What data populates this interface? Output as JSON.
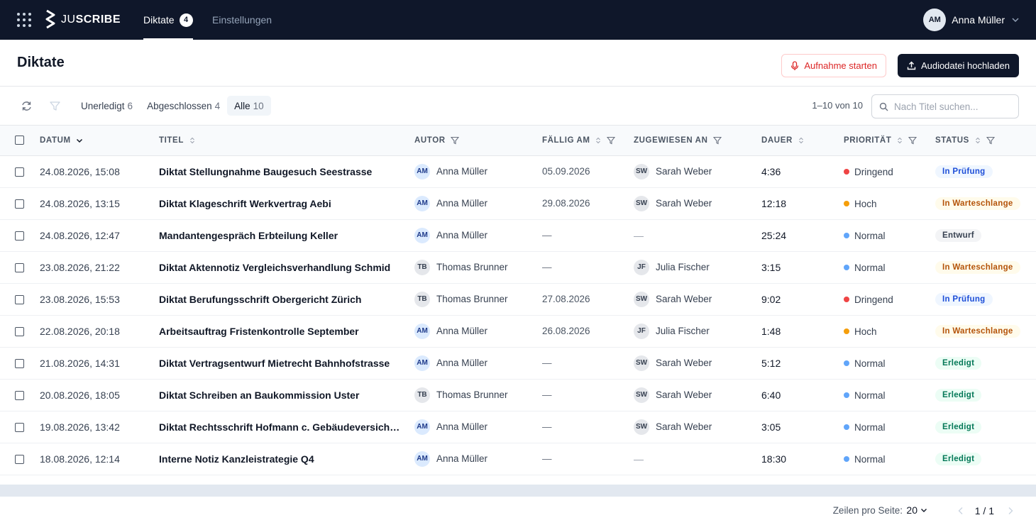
{
  "app": {
    "brand_prefix": "JU",
    "brand_suffix": "SCRIBE",
    "nav": [
      {
        "label": "Diktate",
        "badge": "4",
        "active": true
      },
      {
        "label": "Einstellungen",
        "active": false
      }
    ],
    "user": {
      "initials": "AM",
      "name": "Anna Müller"
    }
  },
  "header": {
    "title": "Diktate",
    "record_label": "Aufnahme starten",
    "upload_label": "Audiodatei hochladen"
  },
  "toolbar": {
    "filters": [
      {
        "label": "Unerledigt",
        "count": "6"
      },
      {
        "label": "Abgeschlossen",
        "count": "4"
      },
      {
        "label": "Alle",
        "count": "10",
        "active": true
      }
    ],
    "range": "1–10 von 10",
    "search_placeholder": "Nach Titel suchen..."
  },
  "columns": {
    "date": "Datum",
    "title": "Titel",
    "author": "Autor",
    "due": "Fällig am",
    "assigned": "Zugewiesen an",
    "duration": "Dauer",
    "priority": "Priorität",
    "status": "Status"
  },
  "rows": [
    {
      "date": "24.08.2026, 15:08",
      "title": "Diktat Stellungnahme Baugesuch Seestrasse",
      "author_initials": "AM",
      "author": "Anna Müller",
      "due": "05.09.2026",
      "assignee_initials": "SW",
      "assignee": "Sarah Weber",
      "duration": "4:36",
      "priority": "Dringend",
      "status": "In Prüfung"
    },
    {
      "date": "24.08.2026, 13:15",
      "title": "Diktat Klageschrift Werkvertrag Aebi",
      "author_initials": "AM",
      "author": "Anna Müller",
      "due": "29.08.2026",
      "assignee_initials": "SW",
      "assignee": "Sarah Weber",
      "duration": "12:18",
      "priority": "Hoch",
      "status": "In Warteschlange"
    },
    {
      "date": "24.08.2026, 12:47",
      "title": "Mandantengespräch Erbteilung Keller",
      "author_initials": "AM",
      "author": "Anna Müller",
      "due": "—",
      "assignee_initials": "",
      "assignee": "—",
      "duration": "25:24",
      "priority": "Normal",
      "status": "Entwurf"
    },
    {
      "date": "23.08.2026, 21:22",
      "title": "Diktat Aktennotiz Vergleichsverhandlung Schmid",
      "author_initials": "TB",
      "author": "Thomas Brunner",
      "due": "—",
      "assignee_initials": "JF",
      "assignee": "Julia Fischer",
      "duration": "3:15",
      "priority": "Normal",
      "status": "In Warteschlange"
    },
    {
      "date": "23.08.2026, 15:53",
      "title": "Diktat Berufungsschrift Obergericht Zürich",
      "author_initials": "TB",
      "author": "Thomas Brunner",
      "due": "27.08.2026",
      "assignee_initials": "SW",
      "assignee": "Sarah Weber",
      "duration": "9:02",
      "priority": "Dringend",
      "status": "In Prüfung"
    },
    {
      "date": "22.08.2026, 20:18",
      "title": "Arbeitsauftrag Fristenkontrolle September",
      "author_initials": "AM",
      "author": "Anna Müller",
      "due": "26.08.2026",
      "assignee_initials": "JF",
      "assignee": "Julia Fischer",
      "duration": "1:48",
      "priority": "Hoch",
      "status": "In Warteschlange"
    },
    {
      "date": "21.08.2026, 14:31",
      "title": "Diktat Vertragsentwurf Mietrecht Bahnhofstrasse",
      "author_initials": "AM",
      "author": "Anna Müller",
      "due": "—",
      "assignee_initials": "SW",
      "assignee": "Sarah Weber",
      "duration": "5:12",
      "priority": "Normal",
      "status": "Erledigt"
    },
    {
      "date": "20.08.2026, 18:05",
      "title": "Diktat Schreiben an Baukommission Uster",
      "author_initials": "TB",
      "author": "Thomas Brunner",
      "due": "—",
      "assignee_initials": "SW",
      "assignee": "Sarah Weber",
      "duration": "6:40",
      "priority": "Normal",
      "status": "Erledigt"
    },
    {
      "date": "19.08.2026, 13:42",
      "title": "Diktat Rechtsschrift Hofmann c. Gebäudeversich…",
      "author_initials": "AM",
      "author": "Anna Müller",
      "due": "—",
      "assignee_initials": "SW",
      "assignee": "Sarah Weber",
      "duration": "3:05",
      "priority": "Normal",
      "status": "Erledigt"
    },
    {
      "date": "18.08.2026, 12:14",
      "title": "Interne Notiz Kanzleistrategie Q4",
      "author_initials": "AM",
      "author": "Anna Müller",
      "due": "—",
      "assignee_initials": "",
      "assignee": "—",
      "duration": "18:30",
      "priority": "Normal",
      "status": "Erledigt"
    }
  ],
  "priority_colors": {
    "Dringend": "#ef4444",
    "Hoch": "#f59e0b",
    "Normal": "#60a5fa"
  },
  "footer": {
    "rows_label": "Zeilen pro Seite:",
    "rows_value": "20",
    "page": "1 / 1"
  }
}
